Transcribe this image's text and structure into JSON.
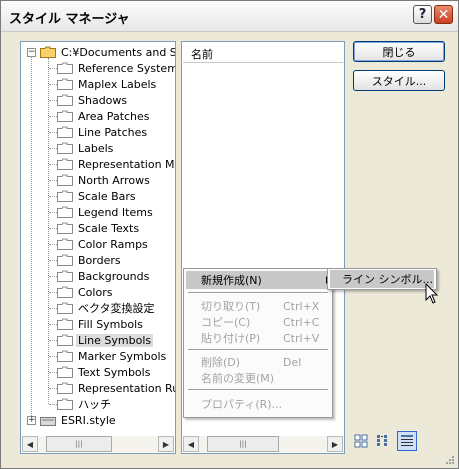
{
  "window": {
    "title": "スタイル マネージャ",
    "help_glyph": "?",
    "close_glyph": "✕"
  },
  "tree": {
    "root": {
      "label": "C:¥Documents and Sett",
      "expander": "−"
    },
    "items": [
      {
        "label": "Reference Systems"
      },
      {
        "label": "Maplex Labels"
      },
      {
        "label": "Shadows"
      },
      {
        "label": "Area Patches"
      },
      {
        "label": "Line Patches"
      },
      {
        "label": "Labels"
      },
      {
        "label": "Representation Mark"
      },
      {
        "label": "North Arrows"
      },
      {
        "label": "Scale Bars"
      },
      {
        "label": "Legend Items"
      },
      {
        "label": "Scale Texts"
      },
      {
        "label": "Color Ramps"
      },
      {
        "label": "Borders"
      },
      {
        "label": "Backgrounds"
      },
      {
        "label": "Colors"
      },
      {
        "label": "ベクタ変換設定"
      },
      {
        "label": "Fill Symbols"
      },
      {
        "label": "Line Symbols"
      },
      {
        "label": "Marker Symbols"
      },
      {
        "label": "Text Symbols"
      },
      {
        "label": "Representation Rule"
      },
      {
        "label": "ハッチ"
      }
    ],
    "selected": "Line Symbols",
    "second_root": {
      "label": "ESRI.style",
      "expander": "+"
    }
  },
  "list": {
    "column_header": "名前"
  },
  "buttons": {
    "close": "閉じる",
    "style": "スタイル..."
  },
  "context_menu": {
    "new": "新規作成(N)",
    "cut": "切り取り(T)",
    "cut_sc": "Ctrl+X",
    "copy": "コピー(C)",
    "copy_sc": "Ctrl+C",
    "paste": "貼り付け(P)",
    "paste_sc": "Ctrl+V",
    "delete": "削除(D)",
    "delete_sc": "Del",
    "rename": "名前の変更(M)",
    "properties": "プロパティ(R)..."
  },
  "submenu": {
    "line_symbol": "ライン シンボル..."
  },
  "colors": {
    "selection": "#dcdcdc",
    "menu_highlight": "#c8c8c8",
    "border": "#7f9db9"
  }
}
